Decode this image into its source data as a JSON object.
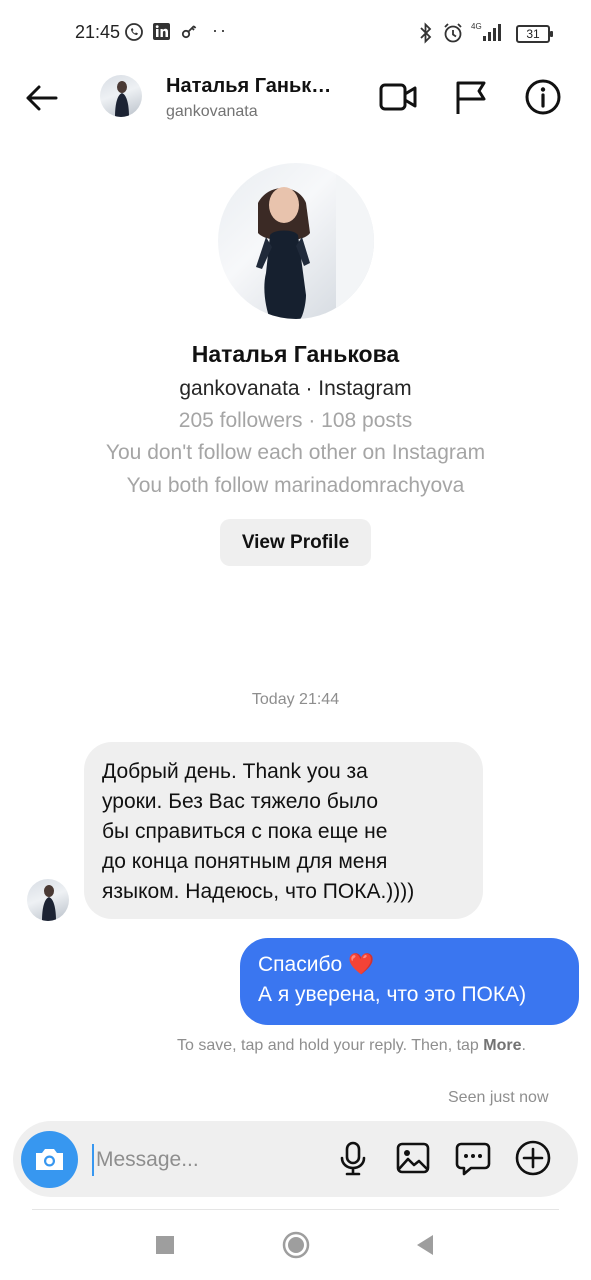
{
  "status_bar": {
    "time": "21:45",
    "battery": "31",
    "network": "4G"
  },
  "header": {
    "name": "Наталья Ганьк…",
    "username": "gankovanata",
    "icons": [
      "back-arrow-icon",
      "video-call-icon",
      "flag-icon",
      "info-icon"
    ]
  },
  "profile": {
    "name": "Наталья Ганькова",
    "line": "gankovanata · Instagram",
    "stats": "205 followers · 108 posts",
    "follow_status": "You don't follow each other on Instagram",
    "mutual": "You both follow marinadomrachyova",
    "view_profile_label": "View Profile"
  },
  "timestamp": "Today 21:44",
  "incoming_message": {
    "lines": [
      "Добрый день. Thank you за",
      "уроки. Без Вас тяжело было",
      "бы справиться с пока еще не",
      "до конца понятным для меня",
      "языком. Надеюсь, что ПОКА.))))"
    ]
  },
  "outgoing_message": {
    "line1": "Спасибо",
    "heart": "❤️",
    "line2": "А я уверена, что это ПОКА)"
  },
  "hint": {
    "text": "To save, tap and hold your reply. Then, tap",
    "bold": "More",
    "end": "."
  },
  "seen": "Seen just now",
  "composer": {
    "placeholder": "Message..."
  },
  "colors": {
    "accent": "#3797f0",
    "outgoing_bubble": "#3a76f0",
    "incoming_bubble": "#efefef",
    "secondary_text": "#8e8e8e"
  }
}
